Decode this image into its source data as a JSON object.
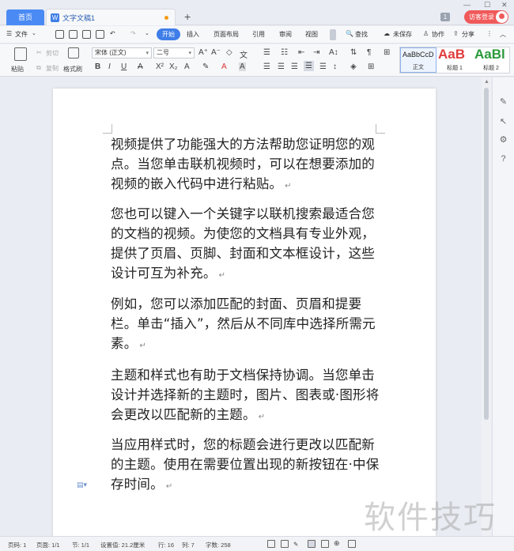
{
  "tabs": {
    "home": "首页",
    "doc_title": "文字文稿1"
  },
  "titlebar": {
    "page_badge": "1",
    "login": "访客登录"
  },
  "menu": {
    "file": "文件",
    "items": [
      "开始",
      "插入",
      "页面布局",
      "引用",
      "审阅",
      "视图"
    ],
    "search": "查找",
    "unsaved": "未保存",
    "collab": "协作",
    "share": "分享"
  },
  "ribbon": {
    "paste": "粘贴",
    "cut": "剪切",
    "copy": "复制",
    "format_painter": "格式刷",
    "font_name": "宋体 (正文)",
    "font_size": "二号",
    "styles": [
      {
        "preview": "AaBbCcD",
        "name": "正文"
      },
      {
        "preview": "AaB",
        "name": "标题 1"
      },
      {
        "preview": "AaBl",
        "name": "标题 2"
      }
    ]
  },
  "document": {
    "paragraphs": [
      "视频提供了功能强大的方法帮助您证明您的观点。当您单击联机视频时，可以在想要添加的视频的嵌入代码中进行粘贴。",
      "您也可以键入一个关键字以联机搜索最适合您的文档的视频。为使您的文档具有专业外观，提供了页眉、页脚、封面和文本框设计，这些设计可互为补充。",
      "例如，您可以添加匹配的封面、页眉和提要栏。单击“插入”，然后从不同库中选择所需元素。",
      "主题和样式也有助于文档保持协调。当您单击设计并选择新的主题时，图片、图表或·图形将会更改以匹配新的主题。",
      "当应用样式时，您的标题会进行更改以匹配新的主题。使用在需要位置出现的新按钮在·中保存时间。"
    ],
    "paragraph_mark": "↵"
  },
  "status": {
    "page_code": "页码: 1",
    "pages": "页面: 1/1",
    "section": "节: 1/1",
    "setting": "设置值: 21.2厘米",
    "row": "行: 16",
    "col": "列: 7",
    "words": "字数: 258"
  },
  "watermark": "软件技巧"
}
